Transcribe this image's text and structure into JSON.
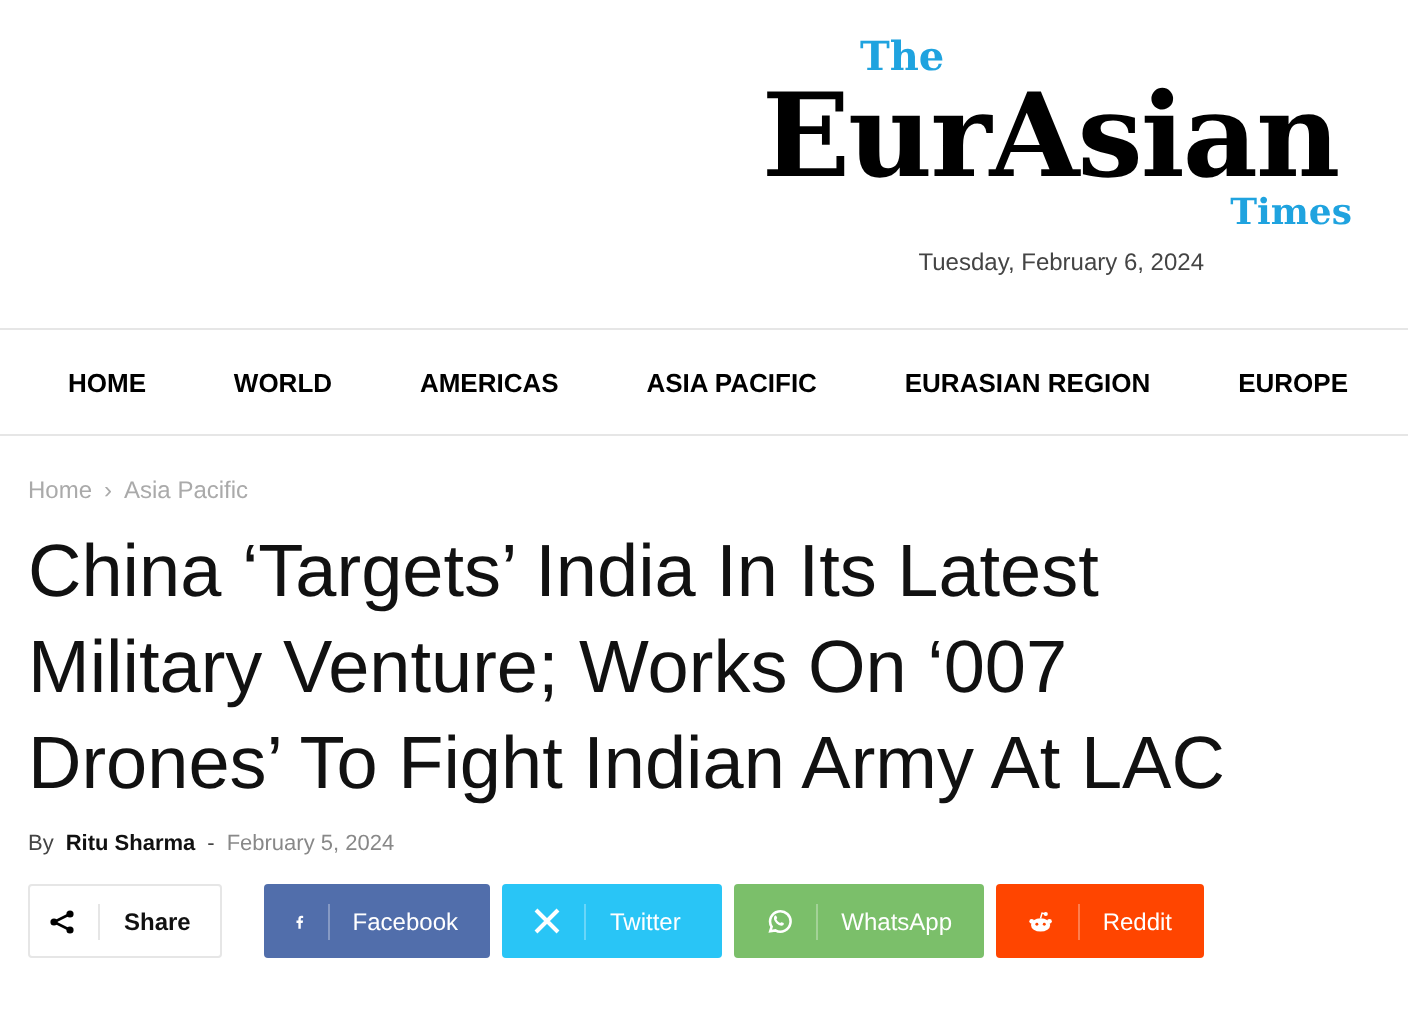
{
  "logo": {
    "top": "The",
    "main": "EurAsian",
    "bottom": "Times"
  },
  "date": "Tuesday, February 6, 2024",
  "nav": [
    {
      "label": "HOME"
    },
    {
      "label": "WORLD"
    },
    {
      "label": "AMERICAS"
    },
    {
      "label": "ASIA PACIFIC"
    },
    {
      "label": "EURASIAN REGION"
    },
    {
      "label": "EUROPE"
    }
  ],
  "breadcrumb": [
    {
      "label": "Home"
    },
    {
      "label": "Asia Pacific"
    }
  ],
  "breadcrumb_separator": "›",
  "article": {
    "title": "China ‘Targets’ India In Its Latest Military Venture; Works On ‘007 Drones’ To Fight Indian Army At LAC",
    "by": "By",
    "author": "Ritu Sharma",
    "separator": "-",
    "date": "February 5, 2024"
  },
  "share": {
    "label": "Share",
    "buttons": [
      {
        "kind": "facebook",
        "label": "Facebook",
        "color": "#516eab"
      },
      {
        "kind": "twitter",
        "label": "Twitter",
        "color": "#29c5f6"
      },
      {
        "kind": "whatsapp",
        "label": "WhatsApp",
        "color": "#7bbf6a"
      },
      {
        "kind": "reddit",
        "label": "Reddit",
        "color": "#ff4500"
      }
    ]
  }
}
